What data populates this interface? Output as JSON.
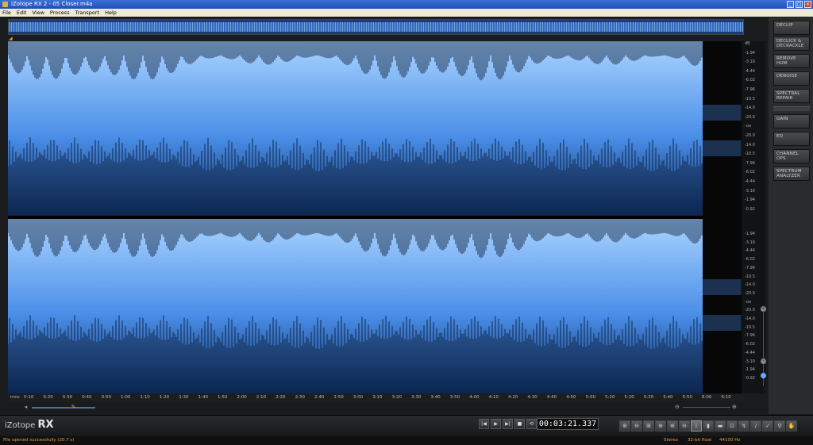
{
  "window": {
    "title": "iZotope RX 2 - 05 Closer.m4a",
    "minimize": "_",
    "maximize": "□",
    "close": "×"
  },
  "menu": [
    "File",
    "Edit",
    "View",
    "Process",
    "Transport",
    "Help"
  ],
  "db_scale": {
    "top_channel": [
      "dB",
      "-1.94",
      "-3.10",
      "-4.44",
      "-6.02",
      "-7.96",
      "-10.5",
      "-14.0",
      "-20.0",
      "-oo",
      "-20.0",
      "-14.0",
      "-10.5",
      "-7.96",
      "-6.02",
      "-4.44",
      "-3.10",
      "-1.94",
      "-0.92"
    ],
    "bottom_channel": [
      "-1.94",
      "-3.10",
      "-4.44",
      "-6.02",
      "-7.96",
      "-10.5",
      "-14.0",
      "-20.0",
      "-oo",
      "-20.0",
      "-14.0",
      "-10.5",
      "-7.96",
      "-6.02",
      "-4.44",
      "-3.10",
      "-1.94",
      "-0.92"
    ]
  },
  "timeline": {
    "unit": "hms",
    "labels": [
      "0:10",
      "0:20",
      "0:30",
      "0:40",
      "0:50",
      "1:00",
      "1:10",
      "1:20",
      "1:30",
      "1:40",
      "1:50",
      "2:00",
      "2:10",
      "2:20",
      "2:30",
      "2:40",
      "2:50",
      "3:00",
      "3:10",
      "3:20",
      "3:30",
      "3:40",
      "3:50",
      "4:00",
      "4:10",
      "4:20",
      "4:30",
      "4:40",
      "4:50",
      "5:00",
      "5:10",
      "5:20",
      "5:30",
      "5:40",
      "5:50",
      "6:00",
      "6:10"
    ]
  },
  "modules": [
    "DECLIP",
    "DECLICK & DECRACKLE",
    "REMOVE HUM",
    "DENOISE",
    "SPECTRAL REPAIR",
    "GAIN",
    "EQ",
    "CHANNEL OPS",
    "SPECTRUM ANALYZER"
  ],
  "logo": {
    "brand": "iZotope",
    "product": "RX"
  },
  "transport": {
    "buttons": [
      "|◀",
      "▶",
      "▶|",
      "■",
      "⟲"
    ],
    "icons": [
      "skip-back-icon",
      "play-icon",
      "skip-forward-icon",
      "stop-icon",
      "loop-icon"
    ]
  },
  "timecode": "00:03:21.337",
  "tools": [
    "zoom-time-icon",
    "zoom-out-icon",
    "zoom-selection-icon",
    "zoom-in-full-icon",
    "zoom-freq-icon",
    "zoom-out-freq-icon",
    "info-icon",
    "time-select-icon",
    "freq-select-icon",
    "time-freq-select-icon",
    "lasso-icon",
    "brush-icon",
    "wand-icon",
    "magnify-icon",
    "hand-icon"
  ],
  "tool_glyphs": [
    "⊕",
    "⊖",
    "⊞",
    "⊕",
    "⊕",
    "⊖",
    "i",
    "▮",
    "▬",
    "⊡",
    "↯",
    "/",
    "✓",
    "⚲",
    "✋"
  ],
  "status": {
    "message": "File opened successfully (20.7 s)",
    "channels": "Stereo",
    "bitdepth": "32-bit float",
    "samplerate": "44100 Hz"
  },
  "colors": {
    "wave_light": "#a9d3ff",
    "wave_mid": "#4a8ee8",
    "wave_dark": "#0d2f66",
    "status_text": "#e8a23a"
  }
}
